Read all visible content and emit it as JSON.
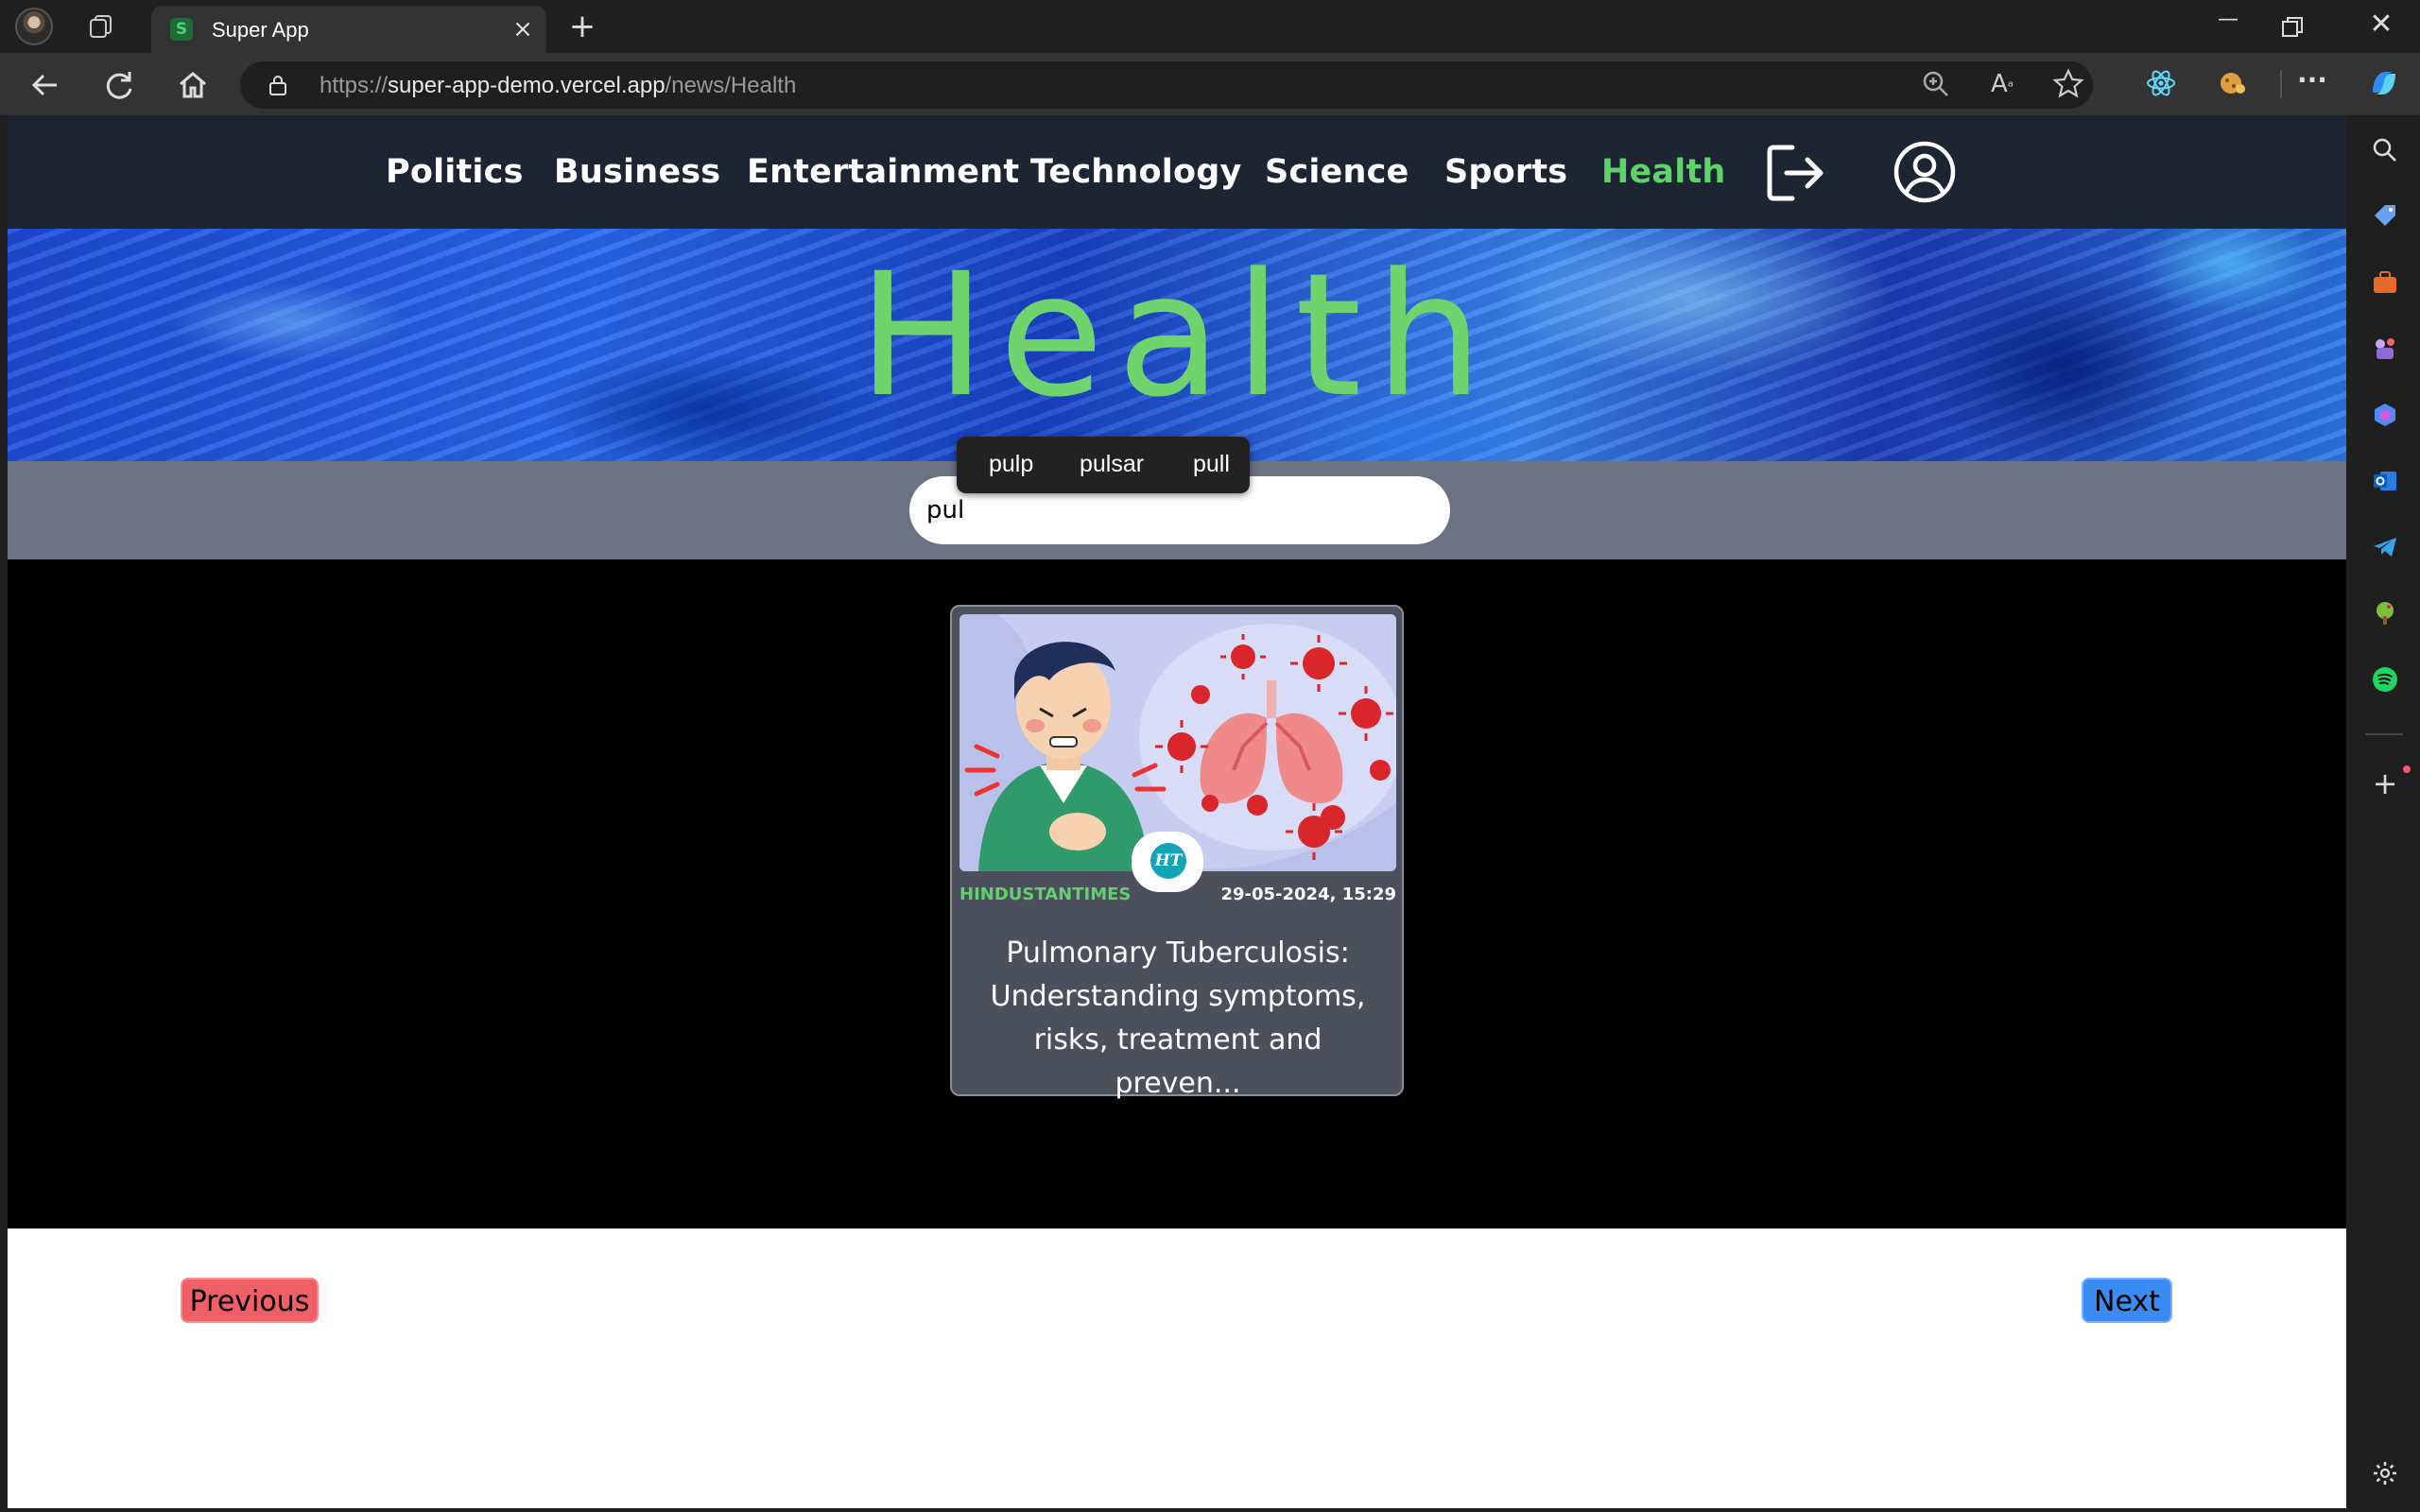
{
  "browser": {
    "tab_title": "Super App",
    "tab_favicon": "S",
    "url_prefix": "https://",
    "url_host": "super-app-demo.vercel.app",
    "url_path": "/news/Health"
  },
  "nav": {
    "links": [
      "Politics",
      "Business",
      "Entertainment",
      "Technology",
      "Science",
      "Sports",
      "Health"
    ],
    "active": "Health",
    "active_color": "#5fd26c"
  },
  "banner": {
    "title": "Health"
  },
  "search": {
    "value": "pul",
    "suggestions": [
      "pulp",
      "pulsar",
      "pull"
    ]
  },
  "articles": [
    {
      "source": "HINDUSTANTIMES",
      "source_logo": "HT",
      "date": "29-05-2024, 15:29",
      "title": "Pulmonary Tuberculosis: Understanding symptoms, risks, treatment and preven..."
    }
  ],
  "pagination": {
    "previous": "Previous",
    "next": "Next"
  },
  "icons": {
    "logout": "logout-icon",
    "profile": "user-circle-icon"
  }
}
